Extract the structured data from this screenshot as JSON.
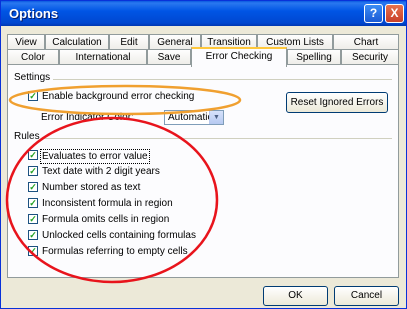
{
  "window": {
    "title": "Options",
    "help_glyph": "?",
    "close_glyph": "X"
  },
  "tabs_row1": [
    {
      "label": "View"
    },
    {
      "label": "Calculation"
    },
    {
      "label": "Edit"
    },
    {
      "label": "General"
    },
    {
      "label": "Transition"
    },
    {
      "label": "Custom Lists"
    },
    {
      "label": "Chart"
    }
  ],
  "tabs_row2": [
    {
      "label": "Color"
    },
    {
      "label": "International"
    },
    {
      "label": "Save"
    },
    {
      "label": "Error Checking",
      "active": true
    },
    {
      "label": "Spelling"
    },
    {
      "label": "Security"
    }
  ],
  "settings": {
    "group_label": "Settings",
    "enable_background": {
      "label": "Enable background error checking",
      "checked": true
    },
    "indicator_color_label": "Error Indicator Color:",
    "indicator_color_value": "Automatic",
    "reset_button": "Reset Ignored Errors"
  },
  "rules": {
    "group_label": "Rules",
    "items": [
      {
        "label": "Evaluates to error value",
        "checked": true
      },
      {
        "label": "Text date with 2 digit years",
        "checked": true
      },
      {
        "label": "Number stored as text",
        "checked": true
      },
      {
        "label": "Inconsistent formula in region",
        "checked": true
      },
      {
        "label": "Formula omits cells in region",
        "checked": true
      },
      {
        "label": "Unlocked cells containing formulas",
        "checked": true
      },
      {
        "label": "Formulas referring to empty cells",
        "checked": true
      }
    ]
  },
  "footer": {
    "ok_button": "OK",
    "cancel_button": "Cancel"
  },
  "annotations": {
    "settings_ellipse_color": "#f0a030",
    "rules_circle_color": "#e8141c"
  },
  "colors": {
    "titlebar_blue": "#0055e5",
    "active_tab_accent": "#ffc83c",
    "check_green": "#21a121"
  }
}
